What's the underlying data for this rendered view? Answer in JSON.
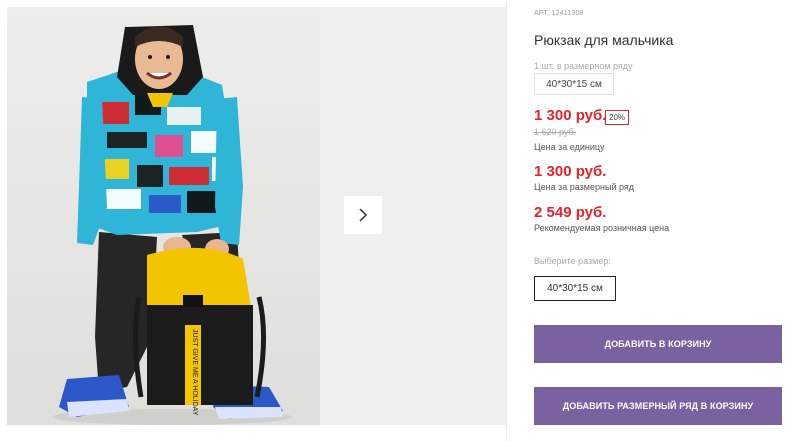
{
  "gallery": {
    "next_icon": "chevron-right-icon"
  },
  "product": {
    "article": "АРТ. 12411308",
    "title": "Рюкзак для мальчика",
    "set_label": "1 шт. в размерном ряду",
    "set_size": "40*30*15 см",
    "price_unit": "1 300 руб.",
    "discount": "20%",
    "old_price": "1 620 руб.",
    "price_unit_label": "Цена за единицу",
    "price_set": "1 300 руб.",
    "price_set_label": "Цена за размерный ряд",
    "price_rrp": "2 549 руб.",
    "price_rrp_label": "Рекомендуемая розничная цена",
    "size_label": "Выберите размер:",
    "size_option": "40*30*15 см"
  },
  "actions": {
    "add_to_cart": "ДОБАВИТЬ В КОРЗИНУ",
    "add_set_to_cart": "ДОБАВИТЬ РАЗМЕРНЫЙ РЯД В КОРЗИНУ"
  },
  "colors": {
    "accent": "#7a619f",
    "price": "#e4232b",
    "backpack_yellow": "#f3c500"
  },
  "backpack_text": "JUST GIVE ME A HOLIDAY"
}
